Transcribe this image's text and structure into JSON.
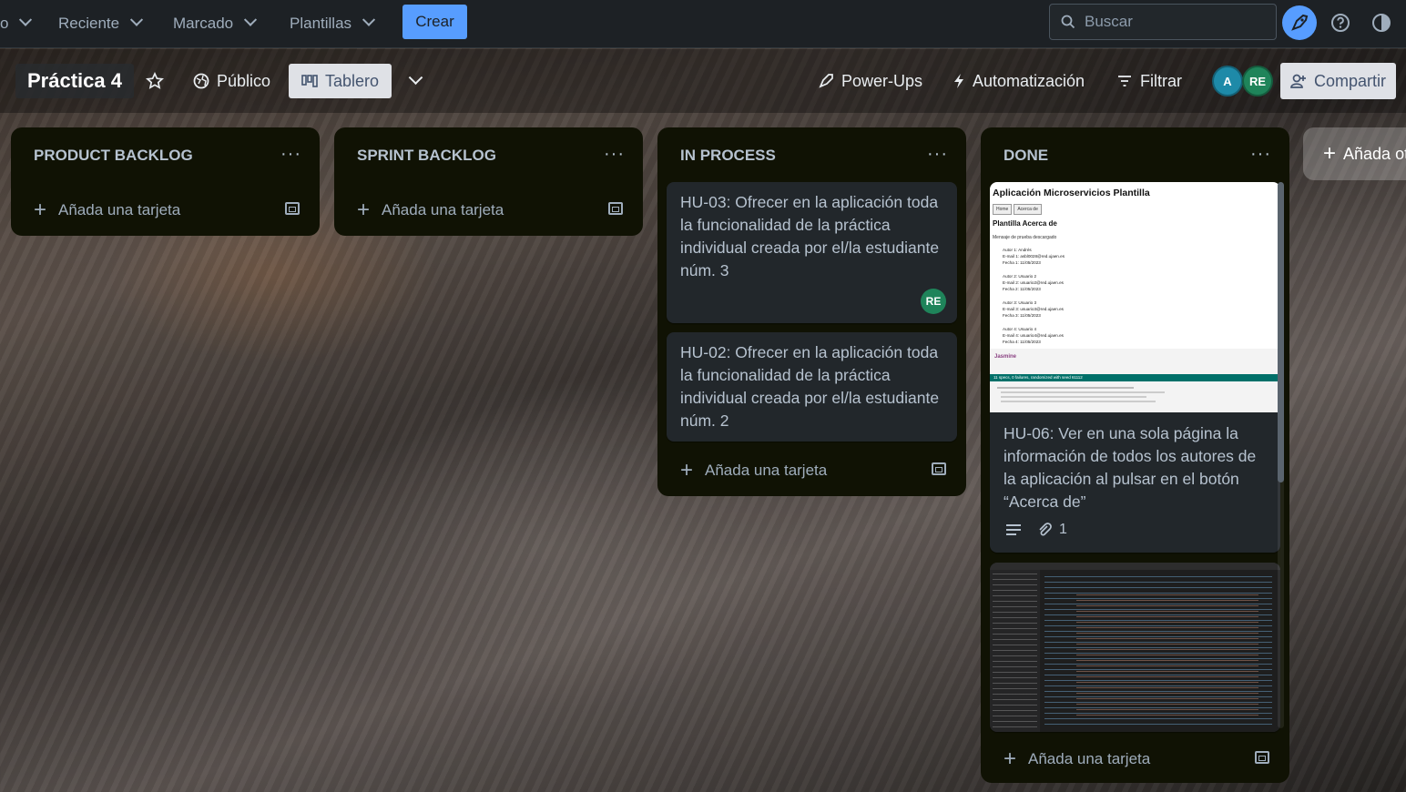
{
  "nav": {
    "partial_left": "o",
    "items": [
      {
        "label": "Reciente"
      },
      {
        "label": "Marcado"
      },
      {
        "label": "Plantillas"
      }
    ],
    "create_label": "Crear",
    "search_placeholder": "Buscar"
  },
  "board": {
    "title": "Práctica 4",
    "visibility": "Público",
    "view": "Tablero",
    "powerups": "Power-Ups",
    "automation": "Automatización",
    "filter": "Filtrar",
    "members": [
      {
        "initials": "A",
        "color": "#1e8aa8"
      },
      {
        "initials": "RE",
        "color": "#1f845a"
      }
    ],
    "share": "Compartir",
    "add_list": "Añada ot"
  },
  "lists": [
    {
      "title": "PRODUCT BACKLOG",
      "add_card": "Añada una tarjeta",
      "cards": []
    },
    {
      "title": "SPRINT BACKLOG",
      "add_card": "Añada una tarjeta",
      "cards": []
    },
    {
      "title": "IN PROCESS",
      "add_card": "Añada una tarjeta",
      "cards": [
        {
          "text": "HU-03: Ofrecer en la aplicación toda la funcionalidad de la práctica individual creada por el/la estudiante núm. 3",
          "member": "RE"
        },
        {
          "text": "HU-02: Ofrecer en la aplicación toda la funcionalidad de la práctica individual creada por el/la estudiante núm. 2"
        }
      ]
    },
    {
      "title": "DONE",
      "add_card": "Añada una tarjeta",
      "cards": [
        {
          "text": "HU-06: Ver en una sola página la información de todos los autores de la aplicación al pulsar en el botón “Acerca de”",
          "attachments": "1",
          "cover": {
            "app_title": "Aplicación Microservicios Plantilla",
            "btn_home": "Home",
            "btn_about": "Acerca de",
            "heading": "Plantilla Acerca de",
            "message": "Mensaje de prueba descargado",
            "authors": [
              {
                "a": "Autor 1: Andrés",
                "e": "E-mail 1: asbl0028@red.ujaen.es",
                "f": "Fecha 1: 11/05/2023"
              },
              {
                "a": "Autor 2: Usuario 2",
                "e": "E-mail 2: usuario2@red.ujaen.es",
                "f": "Fecha 2: 11/05/2023"
              },
              {
                "a": "Autor 3: Usuario 3",
                "e": "E-mail 3: usuario3@red.ujaen.es",
                "f": "Fecha 3: 11/05/2023"
              },
              {
                "a": "Autor 4: Usuario 4",
                "e": "E-mail 4: usuario4@red.ujaen.es",
                "f": "Fecha 4: 11/05/2023"
              }
            ],
            "jasmine": "Jasmine",
            "specs": "11 specs, 0 failures, randomized with seed 61112"
          }
        },
        {
          "text": "",
          "code_cover": true
        }
      ]
    }
  ]
}
